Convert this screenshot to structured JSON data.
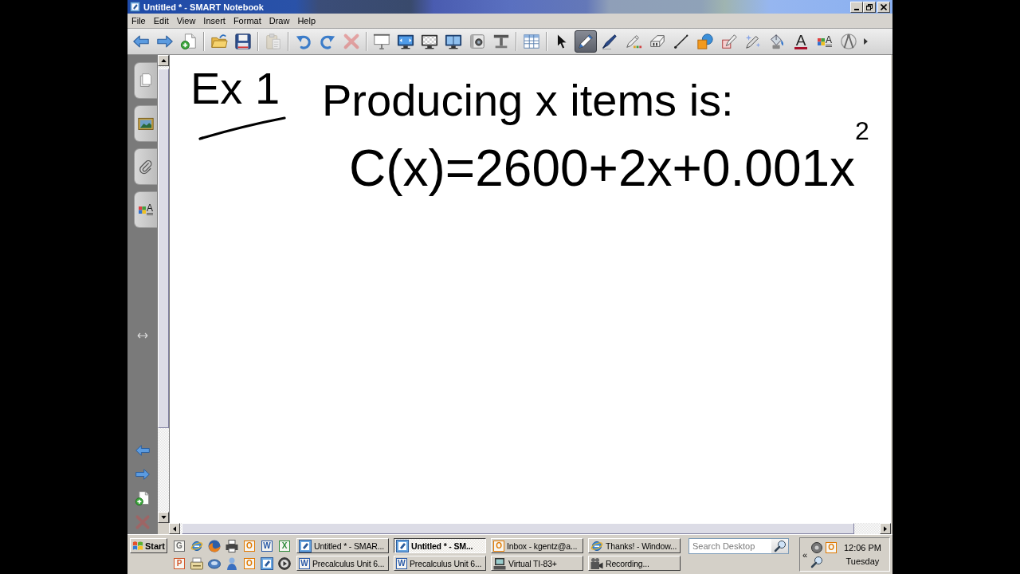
{
  "window": {
    "title": "Untitled * - SMART Notebook"
  },
  "menu": [
    "File",
    "Edit",
    "View",
    "Insert",
    "Format",
    "Draw",
    "Help"
  ],
  "toolbar": [
    {
      "buttons": [
        {
          "kind": "back",
          "disabled": false
        },
        {
          "kind": "forward",
          "disabled": false
        },
        {
          "kind": "add-page",
          "disabled": false
        }
      ]
    },
    {
      "buttons": [
        {
          "kind": "open",
          "disabled": false
        },
        {
          "kind": "save",
          "disabled": false
        }
      ]
    },
    {
      "buttons": [
        {
          "kind": "paste",
          "disabled": true
        }
      ]
    },
    {
      "buttons": [
        {
          "kind": "undo",
          "disabled": false
        },
        {
          "kind": "redo",
          "disabled": false
        },
        {
          "kind": "delete",
          "disabled": true
        }
      ]
    },
    {
      "buttons": [
        {
          "kind": "screen-shade",
          "disabled": false
        },
        {
          "kind": "full-screen",
          "disabled": false
        },
        {
          "kind": "transparent",
          "disabled": false
        },
        {
          "kind": "dual-page",
          "disabled": false
        },
        {
          "kind": "capture",
          "disabled": false
        },
        {
          "kind": "document-camera",
          "disabled": false
        }
      ]
    },
    {
      "buttons": [
        {
          "kind": "table",
          "disabled": false
        }
      ]
    },
    {
      "buttons": [
        {
          "kind": "select",
          "selected": false
        },
        {
          "kind": "pen",
          "selected": true
        },
        {
          "kind": "creative-pen",
          "selected": false
        },
        {
          "kind": "recognition-pen",
          "selected": false
        },
        {
          "kind": "eraser",
          "selected": false
        },
        {
          "kind": "line",
          "selected": false
        },
        {
          "kind": "shapes",
          "selected": false
        },
        {
          "kind": "shape-pen",
          "selected": false
        },
        {
          "kind": "magic-pen",
          "selected": false
        },
        {
          "kind": "fill",
          "selected": false
        },
        {
          "kind": "text",
          "selected": false,
          "glyph": "A"
        },
        {
          "kind": "properties",
          "selected": false,
          "glyph": "A"
        },
        {
          "kind": "measure",
          "selected": false
        }
      ]
    }
  ],
  "sidebar": {
    "tabs": [
      {
        "kind": "page-sorter",
        "selected": false
      },
      {
        "kind": "gallery",
        "selected": false
      },
      {
        "kind": "attachments",
        "selected": false
      },
      {
        "kind": "properties",
        "selected": false,
        "glyph": "A"
      }
    ],
    "buttons": [
      {
        "kind": "back",
        "disabled": false
      },
      {
        "kind": "forward",
        "disabled": false
      },
      {
        "kind": "add-page",
        "disabled": false
      },
      {
        "kind": "delete",
        "disabled": true
      }
    ]
  },
  "canvas": {
    "ink": [
      {
        "kind": "heading",
        "text": "Ex 1",
        "underlined": true
      },
      {
        "kind": "text",
        "text": "Producing x items is:",
        "underlined": false
      },
      {
        "kind": "formula",
        "text": "C(x)=2600+2x+0.001x$^{2}$",
        "underlined": false
      }
    ]
  },
  "taskbar": {
    "start": "Start",
    "quick_launch": [
      {
        "kind": "tile",
        "letter": "G",
        "color": "#6a6a6a"
      },
      {
        "kind": "globe"
      },
      {
        "kind": "fox"
      },
      {
        "kind": "printer"
      },
      {
        "kind": "tile",
        "letter": "O",
        "color": "#e07800"
      },
      {
        "kind": "tile",
        "letter": "W",
        "color": "#2a5aa8"
      },
      {
        "kind": "tile",
        "letter": "X",
        "color": "#2e8b3a"
      },
      {
        "kind": "tile",
        "letter": "P",
        "color": "#d2572a"
      },
      {
        "kind": "scanner"
      },
      {
        "kind": "disc"
      },
      {
        "kind": "figure"
      },
      {
        "kind": "tile",
        "letter": "O",
        "color": "#e07800"
      },
      {
        "kind": "notebook"
      },
      {
        "kind": "media"
      }
    ],
    "tasks": [
      {
        "label": "Untitled * - SMAR...",
        "selected": false,
        "icon": {
          "kind": "notebook"
        }
      },
      {
        "label": "Untitled * - SM...",
        "selected": true,
        "icon": {
          "kind": "notebook"
        }
      },
      {
        "label": "Inbox - kgentz@a...",
        "selected": false,
        "icon": {
          "kind": "tile",
          "letter": "O",
          "color": "#e07800"
        }
      },
      {
        "label": "Thanks! - Window...",
        "selected": false,
        "icon": {
          "kind": "globe"
        }
      },
      {
        "label": "Precalculus Unit 6...",
        "selected": false,
        "icon": {
          "kind": "tile",
          "letter": "W",
          "color": "#2a5aa8"
        }
      },
      {
        "label": "Precalculus Unit 6...",
        "selected": false,
        "icon": {
          "kind": "tile",
          "letter": "W",
          "color": "#2a5aa8"
        }
      },
      {
        "label": "Virtual TI-83+",
        "selected": false,
        "icon": {
          "kind": "computer"
        }
      },
      {
        "label": "Recording...",
        "selected": false,
        "icon": {
          "kind": "camera"
        }
      }
    ],
    "search": {
      "placeholder": "Search Desktop"
    },
    "tray": {
      "expand": "«",
      "icons": [
        {
          "kind": "ring"
        },
        {
          "kind": "tile",
          "letter": "O",
          "color": "#e07800"
        },
        {
          "kind": "magnifier"
        }
      ],
      "time": "12:06 PM",
      "day": "Tuesday"
    }
  }
}
